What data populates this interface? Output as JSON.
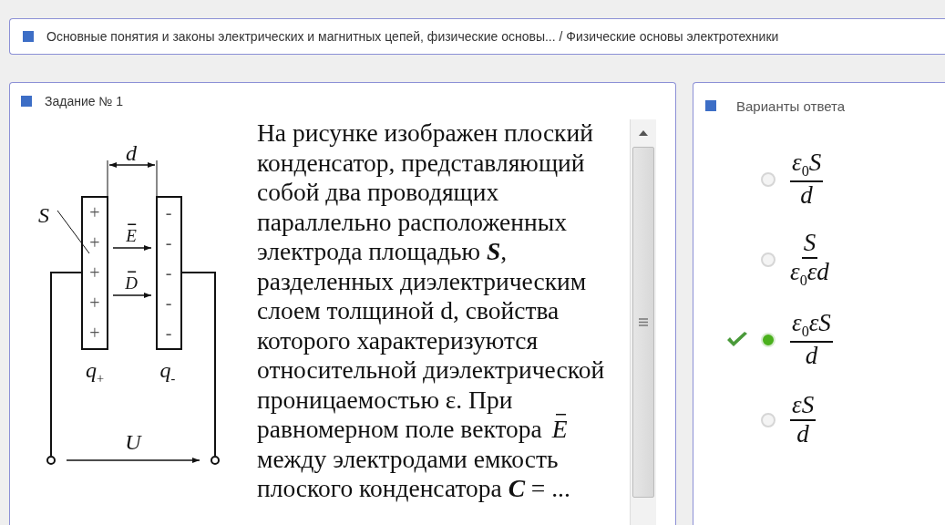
{
  "breadcrumb": {
    "text": "Основные понятия и законы электрических и магнитных цепей, физические основы... / Физические основы электротехники"
  },
  "task": {
    "title": "Задание № 1",
    "diagram": {
      "dimension": "d",
      "area": "S",
      "left_plate_signs": [
        "+",
        "+",
        "+",
        "+",
        "+"
      ],
      "right_plate_signs": [
        "-",
        "-",
        "-",
        "-",
        "-"
      ],
      "field_labels": [
        "E",
        "D"
      ],
      "charges": [
        "q$_{+}$",
        "q$_{-}$"
      ],
      "voltage": "U"
    },
    "question": "На рисунке изображен плоский конденсатор, представляющий собой два проводящих параллельно расположенных электрода площадью **S**, разделенных диэлектрическим слоем толщиной d, свойства которого характеризуются относительной диэлектрической проницаемостью ε. При равномерном поле вектора  *E* между электродами емкость плоского конденсатора  **C** = ..."
  },
  "answers": {
    "title": "Варианты ответа",
    "options": [
      {
        "numerator": "ε$_{0}$S",
        "denominator": "d",
        "selected": false,
        "correct": false
      },
      {
        "numerator": "S",
        "denominator": "ε$_{0}$εd",
        "selected": false,
        "correct": false
      },
      {
        "numerator": "ε$_{0}$εS",
        "denominator": "d",
        "selected": true,
        "correct": true
      },
      {
        "numerator": "εS",
        "denominator": "d",
        "selected": false,
        "correct": false
      }
    ]
  }
}
